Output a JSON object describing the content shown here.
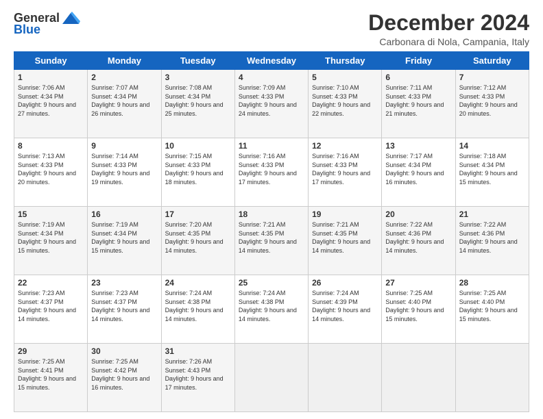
{
  "logo": {
    "general": "General",
    "blue": "Blue"
  },
  "header": {
    "title": "December 2024",
    "subtitle": "Carbonara di Nola, Campania, Italy"
  },
  "weekdays": [
    "Sunday",
    "Monday",
    "Tuesday",
    "Wednesday",
    "Thursday",
    "Friday",
    "Saturday"
  ],
  "weeks": [
    [
      {
        "day": "1",
        "sunrise": "Sunrise: 7:06 AM",
        "sunset": "Sunset: 4:34 PM",
        "daylight": "Daylight: 9 hours and 27 minutes."
      },
      {
        "day": "2",
        "sunrise": "Sunrise: 7:07 AM",
        "sunset": "Sunset: 4:34 PM",
        "daylight": "Daylight: 9 hours and 26 minutes."
      },
      {
        "day": "3",
        "sunrise": "Sunrise: 7:08 AM",
        "sunset": "Sunset: 4:34 PM",
        "daylight": "Daylight: 9 hours and 25 minutes."
      },
      {
        "day": "4",
        "sunrise": "Sunrise: 7:09 AM",
        "sunset": "Sunset: 4:33 PM",
        "daylight": "Daylight: 9 hours and 24 minutes."
      },
      {
        "day": "5",
        "sunrise": "Sunrise: 7:10 AM",
        "sunset": "Sunset: 4:33 PM",
        "daylight": "Daylight: 9 hours and 22 minutes."
      },
      {
        "day": "6",
        "sunrise": "Sunrise: 7:11 AM",
        "sunset": "Sunset: 4:33 PM",
        "daylight": "Daylight: 9 hours and 21 minutes."
      },
      {
        "day": "7",
        "sunrise": "Sunrise: 7:12 AM",
        "sunset": "Sunset: 4:33 PM",
        "daylight": "Daylight: 9 hours and 20 minutes."
      }
    ],
    [
      {
        "day": "8",
        "sunrise": "Sunrise: 7:13 AM",
        "sunset": "Sunset: 4:33 PM",
        "daylight": "Daylight: 9 hours and 20 minutes."
      },
      {
        "day": "9",
        "sunrise": "Sunrise: 7:14 AM",
        "sunset": "Sunset: 4:33 PM",
        "daylight": "Daylight: 9 hours and 19 minutes."
      },
      {
        "day": "10",
        "sunrise": "Sunrise: 7:15 AM",
        "sunset": "Sunset: 4:33 PM",
        "daylight": "Daylight: 9 hours and 18 minutes."
      },
      {
        "day": "11",
        "sunrise": "Sunrise: 7:16 AM",
        "sunset": "Sunset: 4:33 PM",
        "daylight": "Daylight: 9 hours and 17 minutes."
      },
      {
        "day": "12",
        "sunrise": "Sunrise: 7:16 AM",
        "sunset": "Sunset: 4:33 PM",
        "daylight": "Daylight: 9 hours and 17 minutes."
      },
      {
        "day": "13",
        "sunrise": "Sunrise: 7:17 AM",
        "sunset": "Sunset: 4:34 PM",
        "daylight": "Daylight: 9 hours and 16 minutes."
      },
      {
        "day": "14",
        "sunrise": "Sunrise: 7:18 AM",
        "sunset": "Sunset: 4:34 PM",
        "daylight": "Daylight: 9 hours and 15 minutes."
      }
    ],
    [
      {
        "day": "15",
        "sunrise": "Sunrise: 7:19 AM",
        "sunset": "Sunset: 4:34 PM",
        "daylight": "Daylight: 9 hours and 15 minutes."
      },
      {
        "day": "16",
        "sunrise": "Sunrise: 7:19 AM",
        "sunset": "Sunset: 4:34 PM",
        "daylight": "Daylight: 9 hours and 15 minutes."
      },
      {
        "day": "17",
        "sunrise": "Sunrise: 7:20 AM",
        "sunset": "Sunset: 4:35 PM",
        "daylight": "Daylight: 9 hours and 14 minutes."
      },
      {
        "day": "18",
        "sunrise": "Sunrise: 7:21 AM",
        "sunset": "Sunset: 4:35 PM",
        "daylight": "Daylight: 9 hours and 14 minutes."
      },
      {
        "day": "19",
        "sunrise": "Sunrise: 7:21 AM",
        "sunset": "Sunset: 4:35 PM",
        "daylight": "Daylight: 9 hours and 14 minutes."
      },
      {
        "day": "20",
        "sunrise": "Sunrise: 7:22 AM",
        "sunset": "Sunset: 4:36 PM",
        "daylight": "Daylight: 9 hours and 14 minutes."
      },
      {
        "day": "21",
        "sunrise": "Sunrise: 7:22 AM",
        "sunset": "Sunset: 4:36 PM",
        "daylight": "Daylight: 9 hours and 14 minutes."
      }
    ],
    [
      {
        "day": "22",
        "sunrise": "Sunrise: 7:23 AM",
        "sunset": "Sunset: 4:37 PM",
        "daylight": "Daylight: 9 hours and 14 minutes."
      },
      {
        "day": "23",
        "sunrise": "Sunrise: 7:23 AM",
        "sunset": "Sunset: 4:37 PM",
        "daylight": "Daylight: 9 hours and 14 minutes."
      },
      {
        "day": "24",
        "sunrise": "Sunrise: 7:24 AM",
        "sunset": "Sunset: 4:38 PM",
        "daylight": "Daylight: 9 hours and 14 minutes."
      },
      {
        "day": "25",
        "sunrise": "Sunrise: 7:24 AM",
        "sunset": "Sunset: 4:38 PM",
        "daylight": "Daylight: 9 hours and 14 minutes."
      },
      {
        "day": "26",
        "sunrise": "Sunrise: 7:24 AM",
        "sunset": "Sunset: 4:39 PM",
        "daylight": "Daylight: 9 hours and 14 minutes."
      },
      {
        "day": "27",
        "sunrise": "Sunrise: 7:25 AM",
        "sunset": "Sunset: 4:40 PM",
        "daylight": "Daylight: 9 hours and 15 minutes."
      },
      {
        "day": "28",
        "sunrise": "Sunrise: 7:25 AM",
        "sunset": "Sunset: 4:40 PM",
        "daylight": "Daylight: 9 hours and 15 minutes."
      }
    ],
    [
      {
        "day": "29",
        "sunrise": "Sunrise: 7:25 AM",
        "sunset": "Sunset: 4:41 PM",
        "daylight": "Daylight: 9 hours and 15 minutes."
      },
      {
        "day": "30",
        "sunrise": "Sunrise: 7:25 AM",
        "sunset": "Sunset: 4:42 PM",
        "daylight": "Daylight: 9 hours and 16 minutes."
      },
      {
        "day": "31",
        "sunrise": "Sunrise: 7:26 AM",
        "sunset": "Sunset: 4:43 PM",
        "daylight": "Daylight: 9 hours and 17 minutes."
      },
      null,
      null,
      null,
      null
    ]
  ]
}
